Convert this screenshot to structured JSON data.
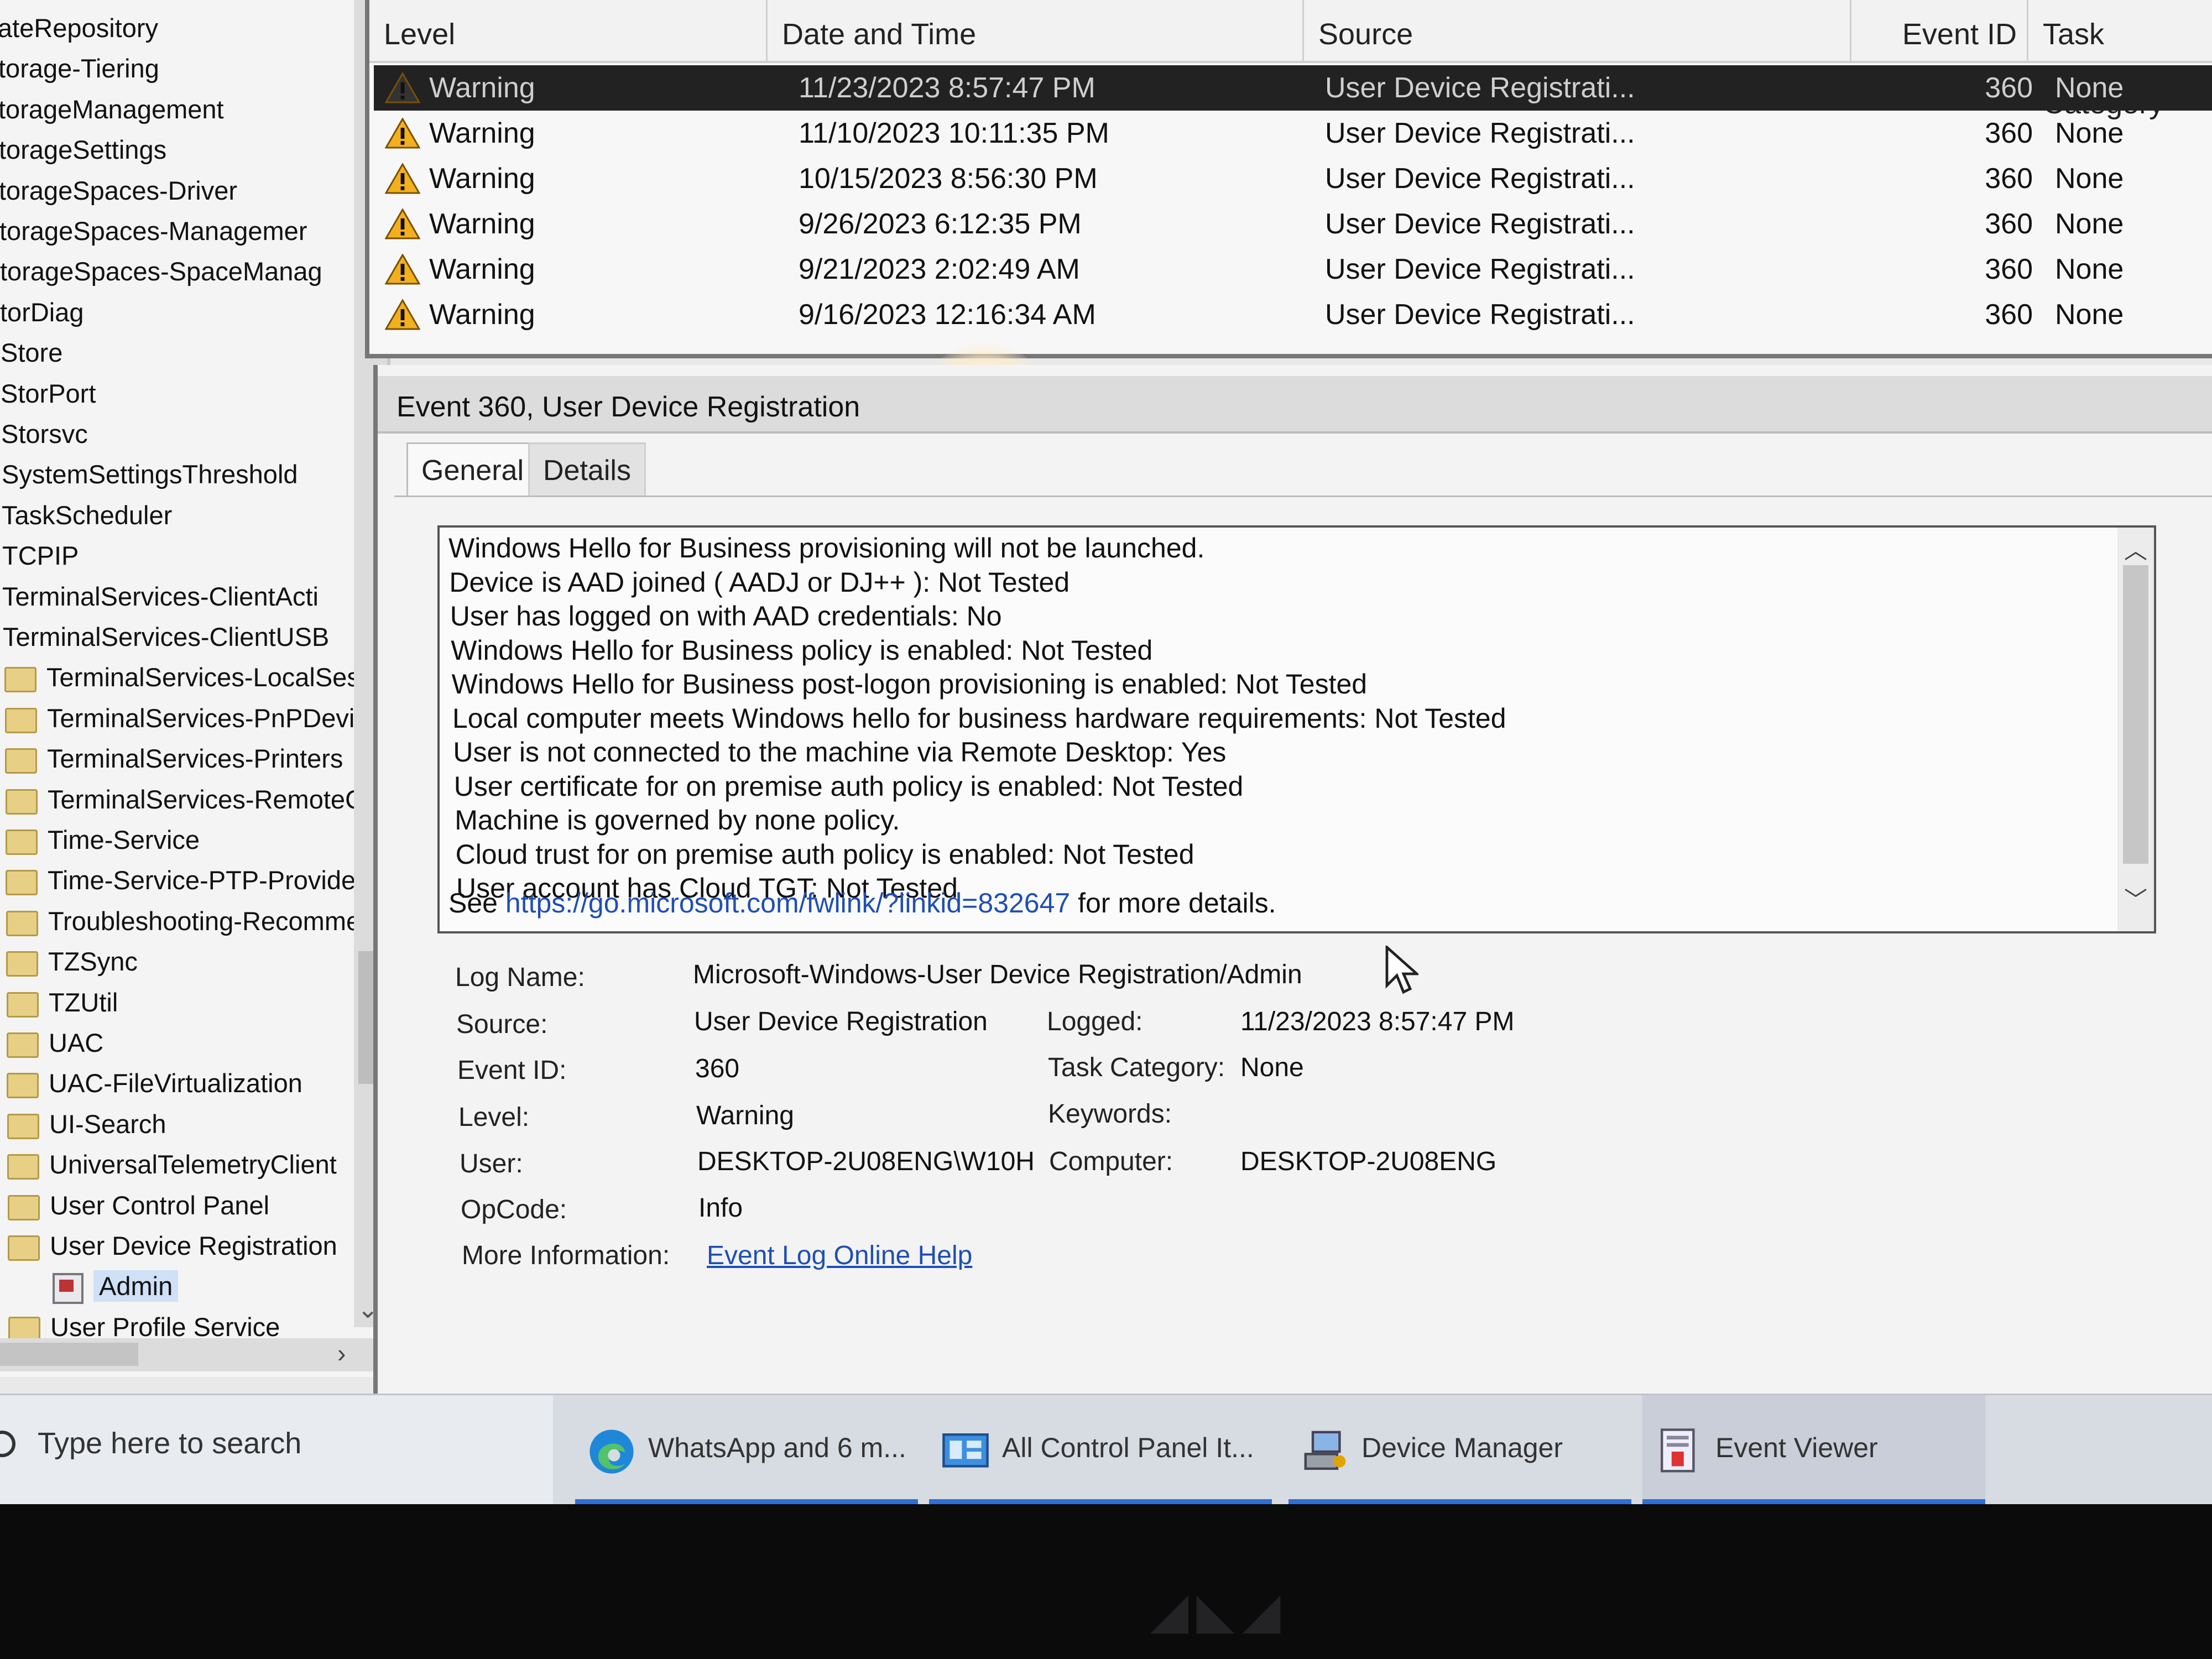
{
  "tree": {
    "items": [
      {
        "label": "ateRepository",
        "folder": false
      },
      {
        "label": "torage-Tiering",
        "folder": false
      },
      {
        "label": "torageManagement",
        "folder": false
      },
      {
        "label": "torageSettings",
        "folder": false
      },
      {
        "label": "torageSpaces-Driver",
        "folder": false
      },
      {
        "label": "torageSpaces-Managemer",
        "folder": false
      },
      {
        "label": "torageSpaces-SpaceManag",
        "folder": false
      },
      {
        "label": "torDiag",
        "folder": false
      },
      {
        "label": "Store",
        "folder": false
      },
      {
        "label": "StorPort",
        "folder": false
      },
      {
        "label": "Storsvc",
        "folder": false
      },
      {
        "label": "SystemSettingsThreshold",
        "folder": false
      },
      {
        "label": "TaskScheduler",
        "folder": false
      },
      {
        "label": "TCPIP",
        "folder": false
      },
      {
        "label": "TerminalServices-ClientActi",
        "folder": false
      },
      {
        "label": "TerminalServices-ClientUSB",
        "folder": false
      },
      {
        "label": "TerminalServices-LocalSessi",
        "folder": true
      },
      {
        "label": "TerminalServices-PnPDevice",
        "folder": true
      },
      {
        "label": "TerminalServices-Printers",
        "folder": true
      },
      {
        "label": "TerminalServices-RemoteCc",
        "folder": true
      },
      {
        "label": "Time-Service",
        "folder": true
      },
      {
        "label": "Time-Service-PTP-Provider",
        "folder": true
      },
      {
        "label": "Troubleshooting-Recomme",
        "folder": true
      },
      {
        "label": "TZSync",
        "folder": true
      },
      {
        "label": "TZUtil",
        "folder": true
      },
      {
        "label": "UAC",
        "folder": true
      },
      {
        "label": "UAC-FileVirtualization",
        "folder": true
      },
      {
        "label": "UI-Search",
        "folder": true
      },
      {
        "label": "UniversalTelemetryClient",
        "folder": true
      },
      {
        "label": "User Control Panel",
        "folder": true
      },
      {
        "label": "User Device Registration",
        "folder": true
      },
      {
        "label": "Admin",
        "folder": false,
        "log": true,
        "selected": true
      },
      {
        "label": "User Profile Service",
        "folder": true
      }
    ]
  },
  "events": {
    "columns": [
      "Level",
      "Date and Time",
      "Source",
      "Event ID",
      "Task Category"
    ],
    "rows": [
      {
        "level": "Warning",
        "datetime": "11/23/2023 8:57:47 PM",
        "source": "User Device Registrati...",
        "id": "360",
        "category": "None",
        "selected": true
      },
      {
        "level": "Warning",
        "datetime": "11/10/2023 10:11:35 PM",
        "source": "User Device Registrati...",
        "id": "360",
        "category": "None"
      },
      {
        "level": "Warning",
        "datetime": "10/15/2023 8:56:30 PM",
        "source": "User Device Registrati...",
        "id": "360",
        "category": "None"
      },
      {
        "level": "Warning",
        "datetime": "9/26/2023 6:12:35 PM",
        "source": "User Device Registrati...",
        "id": "360",
        "category": "None"
      },
      {
        "level": "Warning",
        "datetime": "9/21/2023 2:02:49 AM",
        "source": "User Device Registrati...",
        "id": "360",
        "category": "None"
      },
      {
        "level": "Warning",
        "datetime": "9/16/2023 12:16:34 AM",
        "source": "User Device Registrati...",
        "id": "360",
        "category": "None"
      }
    ]
  },
  "detail": {
    "title": "Event 360, User Device Registration",
    "tabs": [
      "General",
      "Details"
    ],
    "description": [
      "Windows Hello for Business provisioning will not be launched.",
      "Device is AAD joined ( AADJ or DJ++ ): Not Tested",
      "User has logged on with AAD credentials: No",
      "Windows Hello for Business policy is enabled: Not Tested",
      "Windows Hello for Business post-logon provisioning is enabled: Not Tested",
      "Local computer meets Windows hello for business hardware requirements: Not Tested",
      "User is not connected to the machine via Remote Desktop: Yes",
      "User certificate for on premise auth policy is enabled: Not Tested",
      "Machine is governed by none policy.",
      "Cloud trust for on premise auth policy is enabled: Not Tested",
      "User account has Cloud TGT: Not Tested"
    ],
    "see_prefix": "See ",
    "see_link": "https://go.microsoft.com/fwlink/?linkid=832647",
    "see_suffix": " for more details.",
    "fields": {
      "log_name_label": "Log Name:",
      "log_name": "Microsoft-Windows-User Device Registration/Admin",
      "source_label": "Source:",
      "source": "User Device Registration",
      "logged_label": "Logged:",
      "logged": "11/23/2023 8:57:47 PM",
      "event_id_label": "Event ID:",
      "event_id": "360",
      "task_category_label": "Task Category:",
      "task_category": "None",
      "level_label": "Level:",
      "level": "Warning",
      "keywords_label": "Keywords:",
      "keywords": "",
      "user_label": "User:",
      "user": "DESKTOP-2U08ENG\\W10H",
      "computer_label": "Computer:",
      "computer": "DESKTOP-2U08ENG",
      "opcode_label": "OpCode:",
      "opcode": "Info",
      "more_info_label": "More Information:",
      "more_info_link": "Event Log Online Help"
    }
  },
  "taskbar": {
    "search_placeholder": "Type here to search",
    "apps": [
      {
        "label": "WhatsApp and 6 m...",
        "icon": "edge-icon"
      },
      {
        "label": "All Control Panel It...",
        "icon": "control-panel-icon"
      },
      {
        "label": "Device Manager",
        "icon": "device-manager-icon"
      },
      {
        "label": "Event Viewer",
        "icon": "event-viewer-icon",
        "active": true
      }
    ]
  },
  "colors": {
    "warning": "#f2b01e",
    "link": "#1f4fb3",
    "selection": "#222222"
  }
}
